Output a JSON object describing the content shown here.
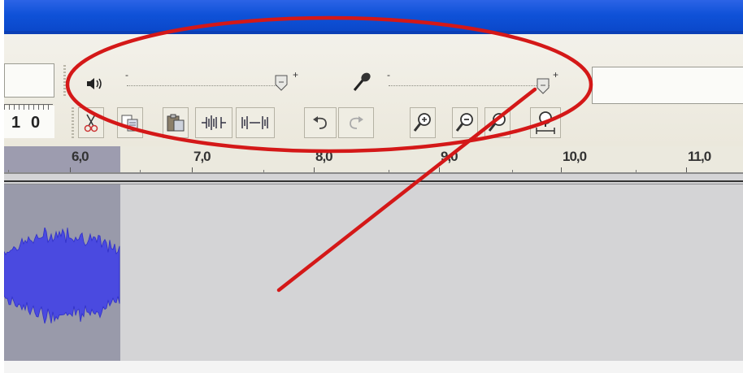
{
  "left_counter": {
    "digits": [
      "1",
      "0"
    ]
  },
  "volume_slider": {
    "minus": "-",
    "plus": "+",
    "value_fraction": 0.97
  },
  "mic_slider": {
    "minus": "-",
    "plus": "+",
    "value_fraction": 0.96
  },
  "icons": {
    "speaker": "speaker-icon",
    "microphone": "microphone-icon",
    "edit_buttons": [
      "cut-icon",
      "copy-icon",
      "paste-icon",
      "trim-icon",
      "silence-icon",
      "undo-icon",
      "redo-icon",
      "zoom-in-icon",
      "zoom-out-icon",
      "fit-selection-icon",
      "fit-project-icon"
    ]
  },
  "ruler": {
    "labels": [
      "6,0",
      "7,0",
      "8,0",
      "9,0",
      "10,0",
      "11,0"
    ]
  },
  "colors": {
    "annotation": "#d41818",
    "selection": "#9d9caf",
    "waveform": "#3a3ad8",
    "titlebar": "#0f52d8"
  }
}
